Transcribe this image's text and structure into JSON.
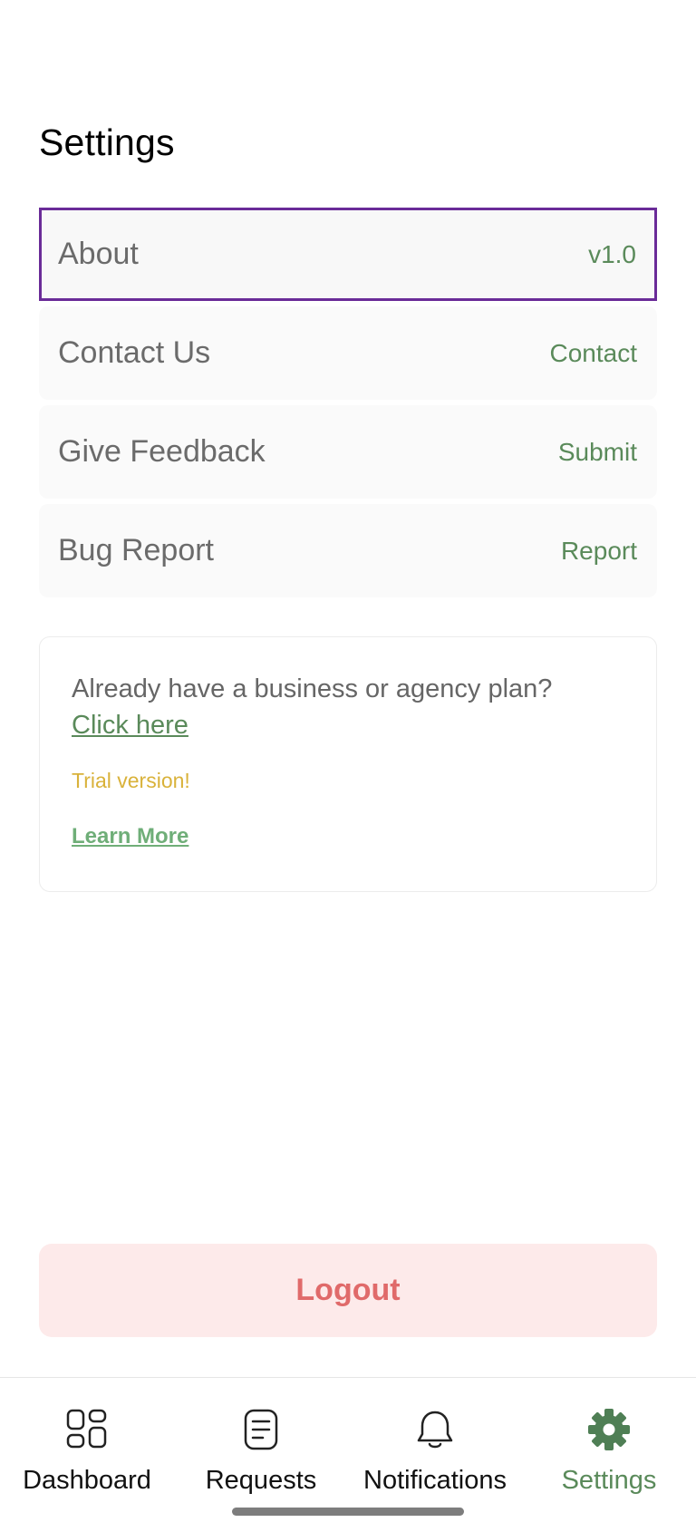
{
  "page": {
    "title": "Settings"
  },
  "settings_rows": [
    {
      "label": "About",
      "action": "v1.0",
      "selected": true
    },
    {
      "label": "Contact Us",
      "action": "Contact",
      "selected": false
    },
    {
      "label": "Give Feedback",
      "action": "Submit",
      "selected": false
    },
    {
      "label": "Bug Report",
      "action": "Report",
      "selected": false
    }
  ],
  "plan_card": {
    "question": "Already have a business or agency plan?",
    "link": "Click here",
    "trial": "Trial version!",
    "learn_more": "Learn More"
  },
  "logout": {
    "label": "Logout"
  },
  "bottom_nav": {
    "items": [
      {
        "label": "Dashboard",
        "icon": "grid-icon",
        "active": false
      },
      {
        "label": "Requests",
        "icon": "document-icon",
        "active": false
      },
      {
        "label": "Notifications",
        "icon": "bell-icon",
        "active": false
      },
      {
        "label": "Settings",
        "icon": "gear-icon",
        "active": true
      }
    ]
  },
  "colors": {
    "accent_green": "#5a8a5a",
    "selected_outline": "#6a2b98",
    "trial_yellow": "#d9b23a",
    "logout_red": "#e06a6a",
    "logout_bg": "#fdeaea"
  }
}
